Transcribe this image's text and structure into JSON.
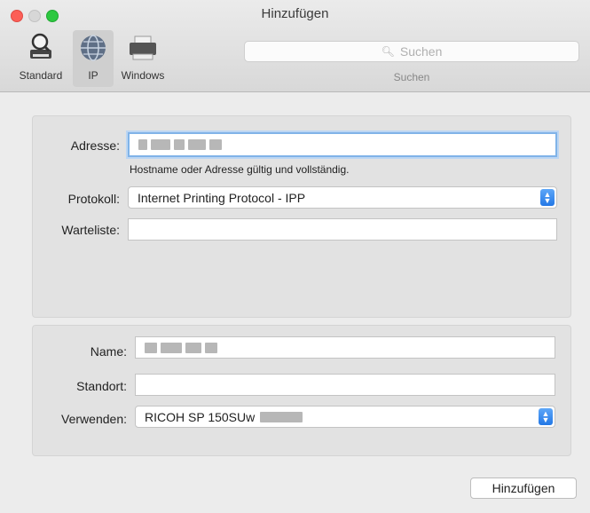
{
  "window": {
    "title": "Hinzufügen"
  },
  "toolbar": {
    "items": [
      {
        "label": "Standard",
        "icon": "printer-magnifier-icon"
      },
      {
        "label": "IP",
        "icon": "globe-icon"
      },
      {
        "label": "Windows",
        "icon": "windows-printer-icon"
      }
    ],
    "selected": "IP",
    "search": {
      "placeholder": "Suchen",
      "caption": "Suchen"
    }
  },
  "ip_form": {
    "address_label": "Adresse:",
    "address_hint": "Hostname oder Adresse gültig und vollständig.",
    "protocol_label": "Protokoll:",
    "protocol_value": "Internet Printing Protocol - IPP",
    "queue_label": "Warteliste:",
    "queue_value": ""
  },
  "printer_form": {
    "name_label": "Name:",
    "location_label": "Standort:",
    "location_value": "",
    "use_label": "Verwenden:",
    "use_value": "RICOH SP 150SUw"
  },
  "actions": {
    "add_button": "Hinzufügen"
  },
  "colors": {
    "accent": "#2a7de8",
    "focus_ring": "#80b3e8"
  }
}
